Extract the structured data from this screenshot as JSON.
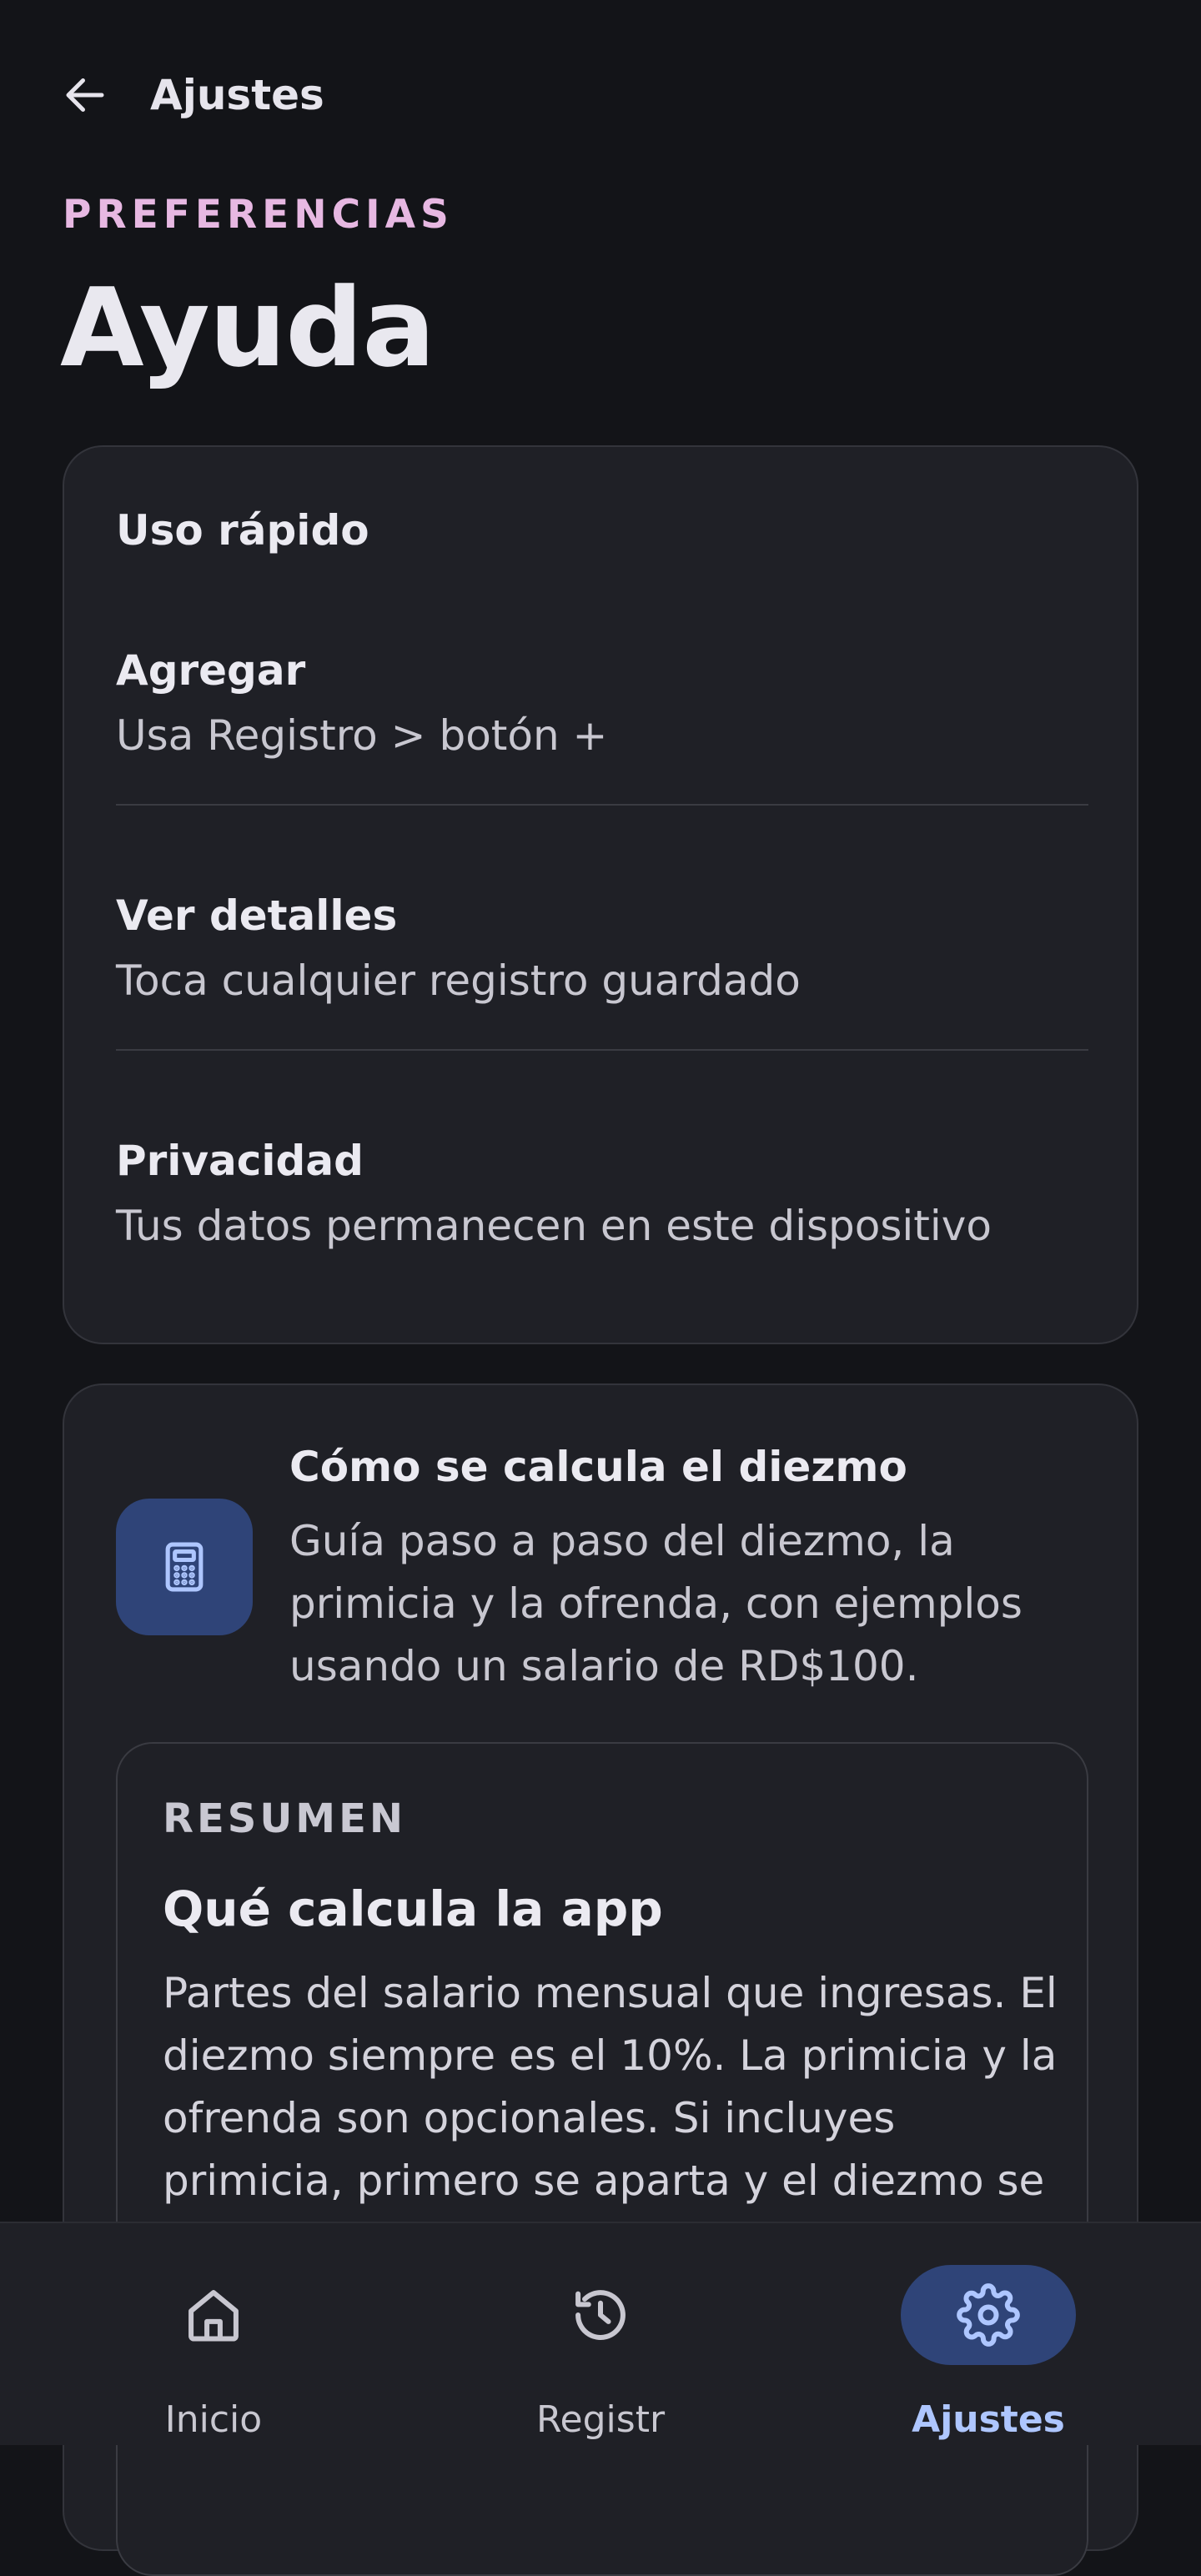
{
  "topbar": {
    "title": "Ajustes"
  },
  "header": {
    "overline": "PREFERENCIAS",
    "title": "Ayuda"
  },
  "quick_use": {
    "title": "Uso rápido",
    "items": [
      {
        "title": "Agregar",
        "description": "Usa Registro > botón +"
      },
      {
        "title": "Ver detalles",
        "description": "Toca cualquier registro guardado"
      },
      {
        "title": "Privacidad",
        "description": "Tus datos permanecen en este dispositivo"
      }
    ]
  },
  "tithe_guide": {
    "icon": "calculator-icon",
    "title": "Cómo se calcula el diezmo",
    "description": "Guía paso a paso del diezmo, la primicia y la ofrenda, con ejemplos usando un salario de RD$100.",
    "summary": {
      "overline": "RESUMEN",
      "title": "Qué calcula la app",
      "body": "Partes del salario mensual que ingresas. El diezmo siempre es el 10%. La primicia y la ofrenda son opcionales. Si incluyes primicia, primero se aparta y el diezmo se"
    }
  },
  "bottom_nav": {
    "items": [
      {
        "label": "Inicio",
        "icon": "home-icon",
        "active": false
      },
      {
        "label": "Registr",
        "icon": "history-icon",
        "active": false
      },
      {
        "label": "Ajustes",
        "icon": "gear-icon",
        "active": true
      }
    ]
  },
  "colors": {
    "background": "#131418",
    "surface": "#1f2026",
    "accent_pink": "#e7b8e2",
    "accent_blue": "#aec6ff",
    "accent_container": "#2f4478"
  }
}
